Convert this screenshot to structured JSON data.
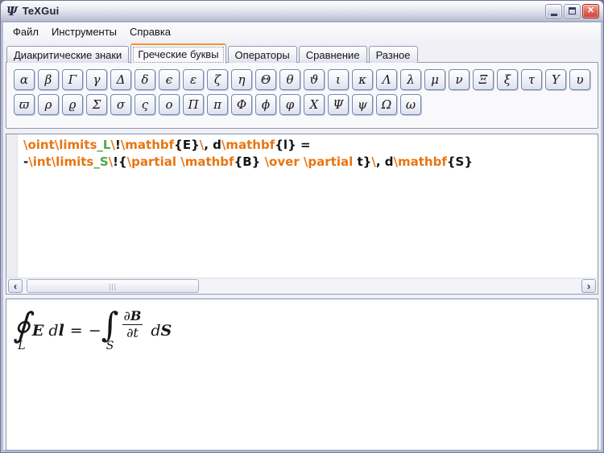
{
  "colors": {
    "command_orange": "#e87511",
    "subscript_green": "#4caa47",
    "tab_accent_orange": "#f49135",
    "close_button_red": "#cc4237"
  },
  "window": {
    "title": "TeXGui",
    "icon_glyph": "Ψ",
    "close_glyph": "✕"
  },
  "menu": {
    "items": [
      {
        "id": "file",
        "label": "Файл"
      },
      {
        "id": "tools",
        "label": "Инструменты"
      },
      {
        "id": "help",
        "label": "Справка"
      }
    ]
  },
  "tabs": [
    {
      "id": "diacritics",
      "label": "Диакритические знаки",
      "active": false
    },
    {
      "id": "greek",
      "label": "Греческие буквы",
      "active": true
    },
    {
      "id": "operators",
      "label": "Операторы",
      "active": false
    },
    {
      "id": "comparison",
      "label": "Сравнение",
      "active": false
    },
    {
      "id": "misc",
      "label": "Разное",
      "active": false
    }
  ],
  "palette": {
    "rows": [
      [
        {
          "name": "alpha",
          "glyph": "α"
        },
        {
          "name": "beta",
          "glyph": "β"
        },
        {
          "name": "Gamma",
          "glyph": "Γ"
        },
        {
          "name": "gamma",
          "glyph": "γ"
        },
        {
          "name": "Delta",
          "glyph": "Δ"
        },
        {
          "name": "delta",
          "glyph": "δ"
        },
        {
          "name": "epsilon",
          "glyph": "ϵ"
        },
        {
          "name": "varepsilon",
          "glyph": "ε"
        },
        {
          "name": "zeta",
          "glyph": "ζ"
        },
        {
          "name": "eta",
          "glyph": "η"
        },
        {
          "name": "Theta",
          "glyph": "Θ"
        },
        {
          "name": "theta",
          "glyph": "θ"
        },
        {
          "name": "vartheta",
          "glyph": "ϑ"
        },
        {
          "name": "iota",
          "glyph": "ι"
        },
        {
          "name": "kappa",
          "glyph": "κ"
        },
        {
          "name": "Lambda",
          "glyph": "Λ"
        },
        {
          "name": "lambda",
          "glyph": "λ"
        },
        {
          "name": "mu",
          "glyph": "μ"
        },
        {
          "name": "nu",
          "glyph": "ν"
        },
        {
          "name": "Xi",
          "glyph": "Ξ"
        },
        {
          "name": "xi",
          "glyph": "ξ"
        },
        {
          "name": "tau",
          "glyph": "τ"
        },
        {
          "name": "Upsilon",
          "glyph": "Υ"
        },
        {
          "name": "upsilon",
          "glyph": "υ"
        }
      ],
      [
        {
          "name": "varpi",
          "glyph": "ϖ"
        },
        {
          "name": "rho",
          "glyph": "ρ"
        },
        {
          "name": "varrho",
          "glyph": "ϱ"
        },
        {
          "name": "Sigma",
          "glyph": "Σ"
        },
        {
          "name": "sigma",
          "glyph": "σ"
        },
        {
          "name": "varsigma",
          "glyph": "ς"
        },
        {
          "name": "omicron",
          "glyph": "ο"
        },
        {
          "name": "Pi",
          "glyph": "Π"
        },
        {
          "name": "pi",
          "glyph": "π"
        },
        {
          "name": "Phi",
          "glyph": "Φ"
        },
        {
          "name": "phi",
          "glyph": "ϕ"
        },
        {
          "name": "varphi",
          "glyph": "φ"
        },
        {
          "name": "Chi",
          "glyph": "Χ"
        },
        {
          "name": "Psi",
          "glyph": "Ψ"
        },
        {
          "name": "psi",
          "glyph": "ψ"
        },
        {
          "name": "Omega",
          "glyph": "Ω"
        },
        {
          "name": "omega",
          "glyph": "ω"
        }
      ]
    ]
  },
  "editor": {
    "lines": [
      [
        {
          "c": "cmd",
          "t": "\\oint\\limits"
        },
        {
          "c": "sub",
          "t": "_L"
        },
        {
          "c": "cmd",
          "t": "\\"
        },
        {
          "c": "bold",
          "t": "!"
        },
        {
          "c": "cmd",
          "t": "\\mathbf"
        },
        {
          "c": "bold",
          "t": "{E}"
        },
        {
          "c": "cmd",
          "t": "\\"
        },
        {
          "c": "bold",
          "t": ", d"
        },
        {
          "c": "cmd",
          "t": "\\mathbf"
        },
        {
          "c": "bold",
          "t": "{l} ="
        }
      ],
      [
        {
          "c": "bold",
          "t": "-"
        },
        {
          "c": "cmd",
          "t": "\\int\\limits"
        },
        {
          "c": "sub",
          "t": "_S"
        },
        {
          "c": "cmd",
          "t": "\\"
        },
        {
          "c": "bold",
          "t": "!"
        },
        {
          "c": "bold",
          "t": "{"
        },
        {
          "c": "cmd",
          "t": "\\partial "
        },
        {
          "c": "cmd",
          "t": "\\mathbf"
        },
        {
          "c": "bold",
          "t": "{B}"
        },
        {
          "c": "cmd",
          "t": " \\over \\partial "
        },
        {
          "c": "bold",
          "t": "t}"
        },
        {
          "c": "cmd",
          "t": "\\"
        },
        {
          "c": "bold",
          "t": ", d"
        },
        {
          "c": "cmd",
          "t": "\\mathbf"
        },
        {
          "c": "bold",
          "t": "{S}"
        }
      ]
    ],
    "scrollbar": {
      "left_arrow": "‹",
      "right_arrow": "›",
      "grip": "|||"
    }
  },
  "preview": {
    "oint": "∮",
    "oint_sub": "L",
    "E": "E",
    "d1": " d",
    "l": "l",
    "equals": "=",
    "minus": "−",
    "int": "∫",
    "int_sub": "S",
    "num_partial": "∂",
    "num_B": "B",
    "den": "∂t",
    "d2": " d",
    "S": "S"
  }
}
